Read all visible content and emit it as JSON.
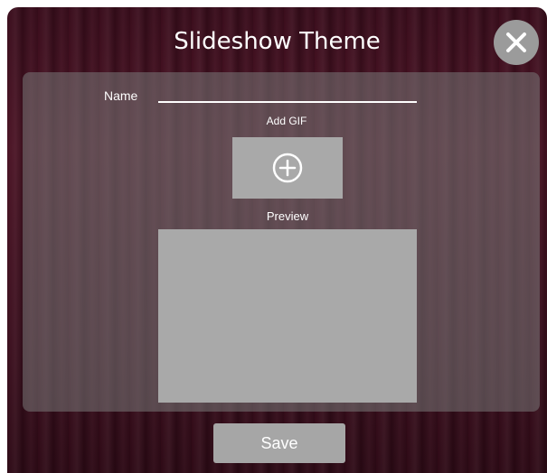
{
  "dialog": {
    "title": "Slideshow Theme",
    "close_icon": "close-icon"
  },
  "form": {
    "name_label": "Name",
    "name_value": "",
    "add_gif_label": "Add GIF",
    "add_icon": "plus-circle-icon",
    "preview_label": "Preview"
  },
  "actions": {
    "save_label": "Save"
  }
}
